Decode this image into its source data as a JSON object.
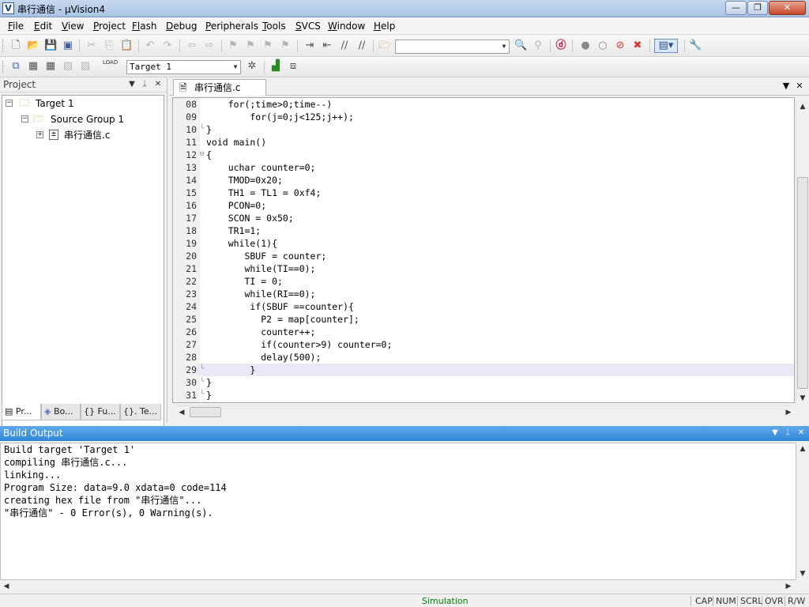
{
  "window": {
    "title": "串行通信 - µVision4",
    "minimize": "—",
    "restore": "❐",
    "close": "✕"
  },
  "menu": [
    {
      "key": "F",
      "rest": "ile"
    },
    {
      "key": "E",
      "rest": "dit"
    },
    {
      "key": "V",
      "rest": "iew"
    },
    {
      "key": "P",
      "rest": "roject"
    },
    {
      "key": "Fl",
      "rest": "ash"
    },
    {
      "key": "D",
      "rest": "ebug"
    },
    {
      "key": "P",
      "rest": "eripherals"
    },
    {
      "key": "T",
      "rest": "ools"
    },
    {
      "key": "S",
      "rest": "VCS"
    },
    {
      "key": "W",
      "rest": "indow"
    },
    {
      "key": "H",
      "rest": "elp"
    }
  ],
  "toolbar": {
    "target_select": "Target 1",
    "find_combo": ""
  },
  "project_panel": {
    "title": "Project",
    "tree": [
      {
        "label": "Target 1",
        "icon": "target-folder-icon"
      },
      {
        "label": "Source Group 1",
        "icon": "folder-icon"
      },
      {
        "label": "串行通信.c",
        "icon": "c-file-icon"
      }
    ],
    "tabs": [
      "Pr...",
      "Bo...",
      "{} Fu...",
      "{}. Te..."
    ]
  },
  "editor": {
    "file_tab": "串行通信.c",
    "highlight_line": "29",
    "lines": [
      {
        "num": "08",
        "text": "    for(;time>0;time--)"
      },
      {
        "num": "09",
        "text": "        for(j=0;j<125;j++);"
      },
      {
        "num": "10",
        "text": "}"
      },
      {
        "num": "11",
        "text": "void main()"
      },
      {
        "num": "12",
        "text": "{"
      },
      {
        "num": "13",
        "text": "    uchar counter=0;"
      },
      {
        "num": "14",
        "text": "    TMOD=0x20;"
      },
      {
        "num": "15",
        "text": "    TH1 = TL1 = 0xf4;"
      },
      {
        "num": "16",
        "text": "    PCON=0;"
      },
      {
        "num": "17",
        "text": "    SCON = 0x50;"
      },
      {
        "num": "18",
        "text": "    TR1=1;"
      },
      {
        "num": "19",
        "text": "    while(1){"
      },
      {
        "num": "20",
        "text": "       SBUF = counter;"
      },
      {
        "num": "21",
        "text": "       while(TI==0);"
      },
      {
        "num": "22",
        "text": "       TI = 0;"
      },
      {
        "num": "23",
        "text": "       while(RI==0);"
      },
      {
        "num": "24",
        "text": "        if(SBUF ==counter){"
      },
      {
        "num": "25",
        "text": "          P2 = map[counter];"
      },
      {
        "num": "26",
        "text": "          counter++;"
      },
      {
        "num": "27",
        "text": "          if(counter>9) counter=0;"
      },
      {
        "num": "28",
        "text": "          delay(500);"
      },
      {
        "num": "29",
        "text": "        }"
      },
      {
        "num": "30",
        "text": "}"
      },
      {
        "num": "31",
        "text": "}"
      }
    ]
  },
  "build_output": {
    "title": "Build Output",
    "lines": [
      "Build target 'Target 1'",
      "compiling 串行通信.c...",
      "linking...",
      "Program Size: data=9.0 xdata=0 code=114",
      "creating hex file from \"串行通信\"...",
      "\"串行通信\" - 0 Error(s), 0 Warning(s)."
    ]
  },
  "status": {
    "mode": "Simulation",
    "cap": "CAP",
    "num": "NUM",
    "scrl": "SCRL",
    "ovr": "OVR",
    "rw": "R/W"
  },
  "colors": {
    "highlight_line_bg": "#e8e8f6",
    "build_header": "#2f86d9",
    "simulation_text": "#008000"
  }
}
